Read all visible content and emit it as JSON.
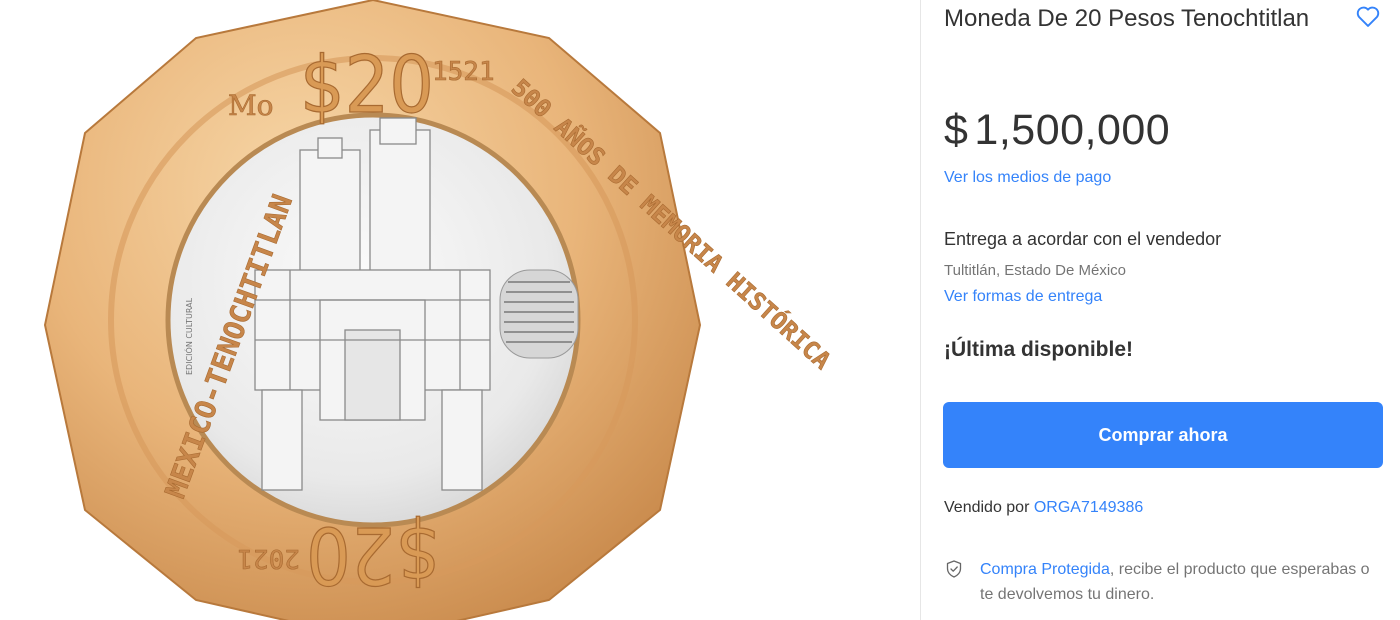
{
  "product": {
    "title": "Moneda De 20 Pesos Tenochtitlan",
    "image_alt": "Moneda de 20 pesos conmemorativa 500 años de memoria histórica",
    "coin": {
      "denomination": "$20",
      "left_text": "MEXICO-TENOCHTITLAN",
      "right_text": "500 AÑOS DE MEMORIA HISTÓRICA",
      "year_top": "1521",
      "year_bottom": "2021",
      "mint_mark": "Mo",
      "center_text": "EDICIÓN CULTURAL"
    },
    "favorite_icon": "heart-outline-icon"
  },
  "price": {
    "currency": "$",
    "amount": "1,500,000",
    "payment_link": "Ver los medios de pago"
  },
  "delivery": {
    "text": "Entrega a acordar con el vendedor",
    "location": "Tultitlán, Estado De México",
    "link": "Ver formas de entrega"
  },
  "stock": {
    "text": "¡Última disponible!"
  },
  "buy_button": {
    "label": "Comprar ahora"
  },
  "seller": {
    "prefix": "Vendido por ",
    "name": "ORGA7149386"
  },
  "protection": {
    "icon": "shield-check-icon",
    "link": "Compra Protegida",
    "text": ", recibe el producto que esperabas o te devolvemos tu dinero."
  },
  "colors": {
    "accent": "#3483fa",
    "text": "#333333",
    "muted": "rgba(0,0,0,0.55)",
    "coin_ring": "#e8b376",
    "coin_center": "#e7e7e7"
  }
}
